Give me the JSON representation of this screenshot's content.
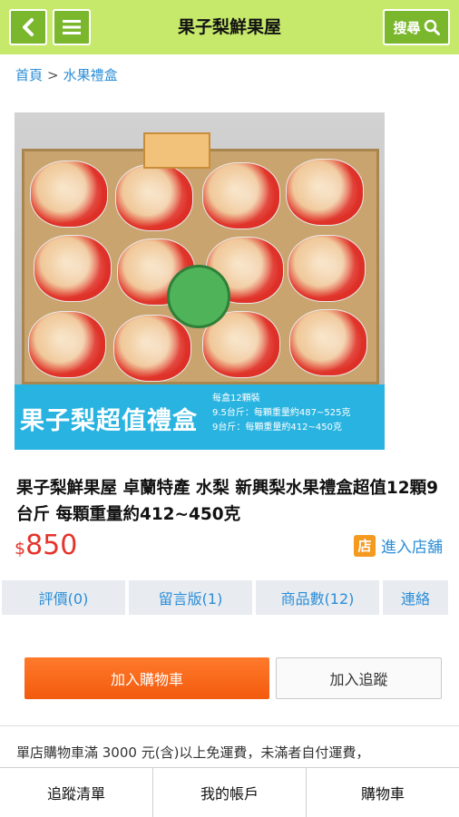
{
  "header": {
    "title": "果子梨鮮果屋",
    "search_label": "搜尋",
    "accent_color": "#c6e96b",
    "button_color": "#7ab72d"
  },
  "breadcrumb": {
    "home": "首頁",
    "separator": ">",
    "current": "水果禮盒"
  },
  "product_image": {
    "banner_title": "果子梨超值禮盒",
    "banner_lines": [
      "每盒12顆裝",
      "9.5台斤：每顆重量約487~525克",
      "9台斤：每顆重量約412~450克"
    ]
  },
  "product": {
    "title": "果子梨鮮果屋 卓蘭特產 水梨 新興梨水果禮盒超值12顆9台斤 每顆重量約412~450克",
    "currency": "$",
    "price": "850",
    "price_color": "#e5342b"
  },
  "store": {
    "icon_char": "店",
    "label": "進入店舖"
  },
  "tabs": [
    {
      "label": "評價(0)"
    },
    {
      "label": "留言版(1)"
    },
    {
      "label": "商品數(12)"
    },
    {
      "label": "連絡"
    }
  ],
  "actions": {
    "add_to_cart": "加入購物車",
    "add_to_tracking": "加入追蹤"
  },
  "shipping_notice": "單店購物車滿 3000 元(含)以上免運費，未滿者自付運費，",
  "bottom_nav": [
    {
      "label": "追蹤清單"
    },
    {
      "label": "我的帳戶"
    },
    {
      "label": "購物車"
    }
  ]
}
